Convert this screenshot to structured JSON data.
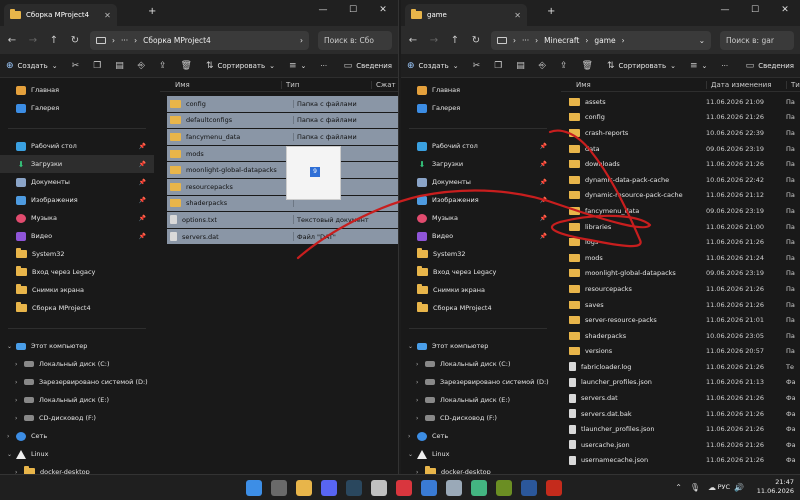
{
  "left": {
    "tab_title": "Сборка MProject4",
    "address": "Сборка MProject4",
    "search_placeholder": "Поиск в: Сбо",
    "toolbar": {
      "create": "Создать",
      "sort": "Сортировать",
      "details": "Сведения"
    },
    "columns": {
      "name": "Имя",
      "type": "Тип",
      "size": "Сжат"
    },
    "files": [
      {
        "name": "config",
        "type": "Папка с файлами",
        "kind": "folder"
      },
      {
        "name": "defaultconfigs",
        "type": "Папка с файлами",
        "kind": "folder"
      },
      {
        "name": "fancymenu_data",
        "type": "Папка с файлами",
        "kind": "folder"
      },
      {
        "name": "mods",
        "type": "",
        "kind": "folder"
      },
      {
        "name": "moonlight-global-datapacks",
        "type": "",
        "kind": "folder"
      },
      {
        "name": "resourcepacks",
        "type": "",
        "kind": "folder"
      },
      {
        "name": "shaderpacks",
        "type": "",
        "kind": "folder"
      },
      {
        "name": "options.txt",
        "type": "Текстовый документ",
        "kind": "file"
      },
      {
        "name": "servers.dat",
        "type": "Файл \"DAT\"",
        "kind": "file"
      }
    ],
    "drag_count": "9"
  },
  "right": {
    "tab_title": "game",
    "address": [
      "Minecraft",
      "game"
    ],
    "search_placeholder": "Поиск в: gar",
    "toolbar": {
      "create": "Создать",
      "sort": "Сортировать",
      "details": "Сведения"
    },
    "columns": {
      "name": "Имя",
      "date": "Дата изменения",
      "type": "Ти"
    },
    "files": [
      {
        "name": "assets",
        "date": "11.06.2026 21:09",
        "type": "Па",
        "kind": "folder"
      },
      {
        "name": "config",
        "date": "11.06.2026 21:26",
        "type": "Па",
        "kind": "folder"
      },
      {
        "name": "crash-reports",
        "date": "10.06.2026 22:39",
        "type": "Па",
        "kind": "folder"
      },
      {
        "name": "data",
        "date": "09.06.2026 23:19",
        "type": "Па",
        "kind": "folder"
      },
      {
        "name": "downloads",
        "date": "11.06.2026 21:26",
        "type": "Па",
        "kind": "folder"
      },
      {
        "name": "dynamic-data-pack-cache",
        "date": "10.06.2026 22:42",
        "type": "Па",
        "kind": "folder"
      },
      {
        "name": "dynamic-resource-pack-cache",
        "date": "11.06.2026 21:12",
        "type": "Па",
        "kind": "folder"
      },
      {
        "name": "fancymenu_data",
        "date": "09.06.2026 23:19",
        "type": "Па",
        "kind": "folder"
      },
      {
        "name": "libraries",
        "date": "11.06.2026 21:00",
        "type": "Па",
        "kind": "folder"
      },
      {
        "name": "logs",
        "date": "11.06.2026 21:26",
        "type": "Па",
        "kind": "folder"
      },
      {
        "name": "mods",
        "date": "11.06.2026 21:24",
        "type": "Па",
        "kind": "folder"
      },
      {
        "name": "moonlight-global-datapacks",
        "date": "09.06.2026 23:19",
        "type": "Па",
        "kind": "folder"
      },
      {
        "name": "resourcepacks",
        "date": "11.06.2026 21:26",
        "type": "Па",
        "kind": "folder"
      },
      {
        "name": "saves",
        "date": "11.06.2026 21:26",
        "type": "Па",
        "kind": "folder"
      },
      {
        "name": "server-resource-packs",
        "date": "11.06.2026 21:01",
        "type": "Па",
        "kind": "folder"
      },
      {
        "name": "shaderpacks",
        "date": "10.06.2026 23:05",
        "type": "Па",
        "kind": "folder"
      },
      {
        "name": "versions",
        "date": "11.06.2026 20:57",
        "type": "Па",
        "kind": "folder"
      },
      {
        "name": "fabricloader.log",
        "date": "11.06.2026 21:26",
        "type": "Те",
        "kind": "file"
      },
      {
        "name": "launcher_profiles.json",
        "date": "11.06.2026 21:13",
        "type": "Фа",
        "kind": "file"
      },
      {
        "name": "servers.dat",
        "date": "11.06.2026 21:26",
        "type": "Фа",
        "kind": "file"
      },
      {
        "name": "servers.dat.bak",
        "date": "11.06.2026 21:26",
        "type": "Фа",
        "kind": "file"
      },
      {
        "name": "tlauncher_profiles.json",
        "date": "11.06.2026 21:26",
        "type": "Фа",
        "kind": "file"
      },
      {
        "name": "usercache.json",
        "date": "11.06.2026 21:26",
        "type": "Фа",
        "kind": "file"
      },
      {
        "name": "usernamecache.json",
        "date": "11.06.2026 21:26",
        "type": "Фа",
        "kind": "file"
      }
    ]
  },
  "sidebar": {
    "home": "Главная",
    "gallery": "Галерея",
    "quick": [
      {
        "label": "Рабочий стол",
        "icon": "desktop-icon"
      },
      {
        "label": "Загрузки",
        "icon": "downloads-icon"
      },
      {
        "label": "Документы",
        "icon": "documents-icon"
      },
      {
        "label": "Изображения",
        "icon": "pictures-icon"
      },
      {
        "label": "Музыка",
        "icon": "music-icon"
      },
      {
        "label": "Видео",
        "icon": "video-icon"
      }
    ],
    "folders": [
      "System32",
      "Вход через Legacy",
      "Снимки экрана",
      "Сборка MProject4"
    ],
    "this_pc": "Этот компьютер",
    "drives": [
      "Локальный диск (C:)",
      "Зарезервировано системой (D:)",
      "Локальный диск (E:)",
      "CD-дисковод (F:)"
    ],
    "network": "Сеть",
    "linux": "Linux",
    "docker": "docker-desktop"
  },
  "taskbar": {
    "lang": "РУС",
    "time": "21:47",
    "date": "11.06.2026",
    "apps": [
      {
        "name": "start-button",
        "color": "#3d8ee6"
      },
      {
        "name": "search-app",
        "color": "#6a6a6a"
      },
      {
        "name": "explorer-app",
        "color": "#e8b54a"
      },
      {
        "name": "discord-app",
        "color": "#5865f2"
      },
      {
        "name": "steam-app",
        "color": "#2a475e"
      },
      {
        "name": "app-circle",
        "color": "#c0c0c0"
      },
      {
        "name": "vivaldi-app",
        "color": "#d9363e"
      },
      {
        "name": "app-shield",
        "color": "#3a7bd5"
      },
      {
        "name": "app-cat",
        "color": "#9aa9b8"
      },
      {
        "name": "app-green",
        "color": "#43b581"
      },
      {
        "name": "minecraft-app",
        "color": "#6b8e23"
      },
      {
        "name": "word-app",
        "color": "#2b579a"
      },
      {
        "name": "app-red",
        "color": "#c42b1c"
      }
    ]
  }
}
